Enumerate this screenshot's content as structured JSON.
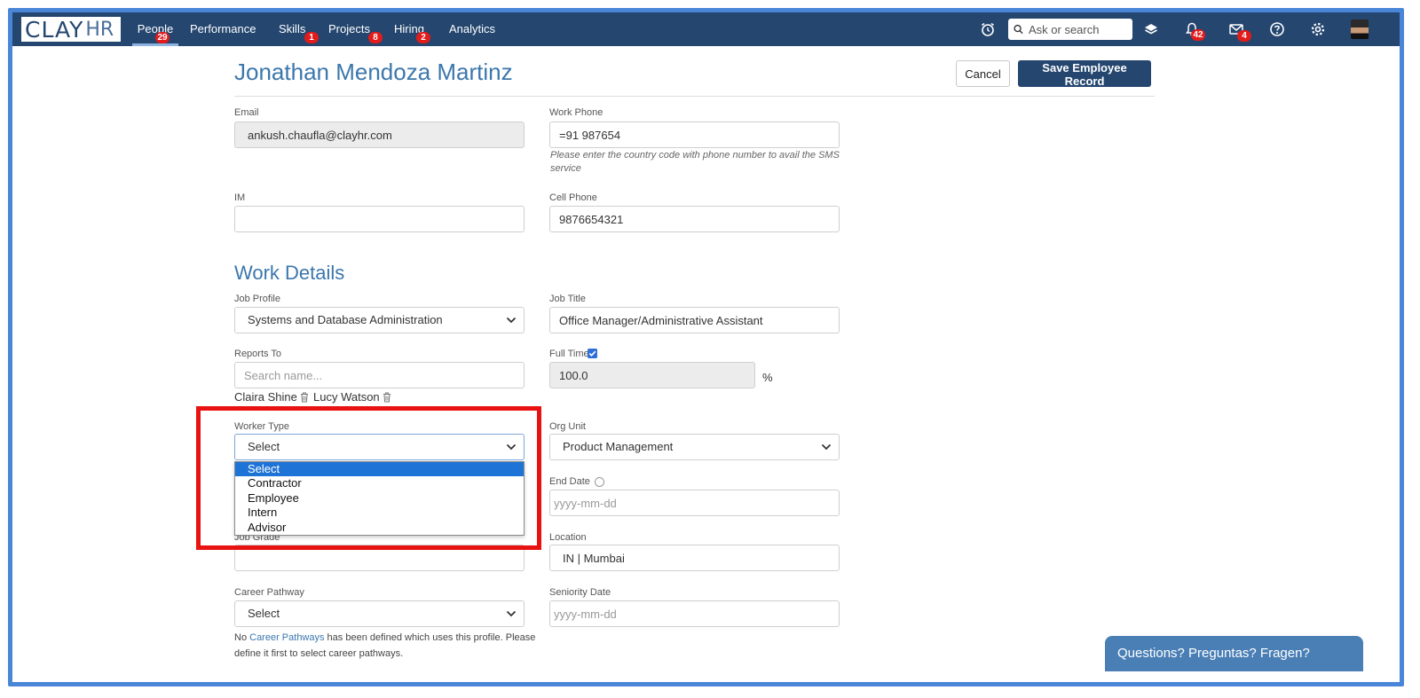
{
  "brand": {
    "logo_main": "CLAY",
    "logo_sub": "HR"
  },
  "nav": {
    "items": [
      {
        "label": "People",
        "badge": "29"
      },
      {
        "label": "Performance",
        "badge": ""
      },
      {
        "label": "Skills",
        "badge": "1"
      },
      {
        "label": "Projects",
        "badge": "8"
      },
      {
        "label": "Hiring",
        "badge": "2"
      },
      {
        "label": "Analytics",
        "badge": ""
      }
    ],
    "search_placeholder": "Ask or search",
    "notifications_badge": "42",
    "messages_badge": "4"
  },
  "page": {
    "title": "Jonathan Mendoza Martinz",
    "cancel_label": "Cancel",
    "save_label": "Save Employee Record"
  },
  "contact": {
    "email_label": "Email",
    "email_value": "ankush.chaufla@clayhr.com",
    "work_phone_label": "Work Phone",
    "work_phone_value": "=91 987654",
    "work_phone_hint": "Please enter the country code with phone number to avail the SMS service",
    "im_label": "IM",
    "im_value": "",
    "cell_phone_label": "Cell Phone",
    "cell_phone_value": "9876654321"
  },
  "work": {
    "section_title": "Work Details",
    "job_profile_label": "Job Profile",
    "job_profile_value": "Systems and Database Administration",
    "job_title_label": "Job Title",
    "job_title_value": "Office Manager/Administrative Assistant",
    "reports_to_label": "Reports To",
    "reports_to_placeholder": "Search name...",
    "reports_to_people": [
      "Claira Shine",
      "Lucy Watson"
    ],
    "full_time_label": "Full Time",
    "full_time_checked": true,
    "full_time_value": "100.0",
    "full_time_unit": "%",
    "worker_type_label": "Worker Type",
    "worker_type_value": "Select",
    "worker_type_options": [
      "Select",
      "Contractor",
      "Employee",
      "Intern",
      "Advisor"
    ],
    "org_unit_label": "Org Unit",
    "org_unit_value": "Product Management",
    "end_date_label": "End Date",
    "end_date_placeholder": "yyyy-mm-dd",
    "job_grade_label": "Job Grade",
    "location_label": "Location",
    "location_value": "IN | Mumbai",
    "career_pathway_label": "Career Pathway",
    "career_pathway_value": "Select",
    "seniority_date_label": "Seniority Date",
    "seniority_date_placeholder": "yyyy-mm-dd",
    "note_prefix": "No ",
    "note_link": "Career Pathways",
    "note_suffix": " has been defined which uses this profile. Please define it first to select career pathways."
  },
  "chat": {
    "label": "Questions? Preguntas? Fragen?"
  },
  "colors": {
    "nav_bg": "#24466f",
    "accent": "#3b77ad",
    "highlight": "#e81212",
    "option_selected": "#1e74d6"
  }
}
